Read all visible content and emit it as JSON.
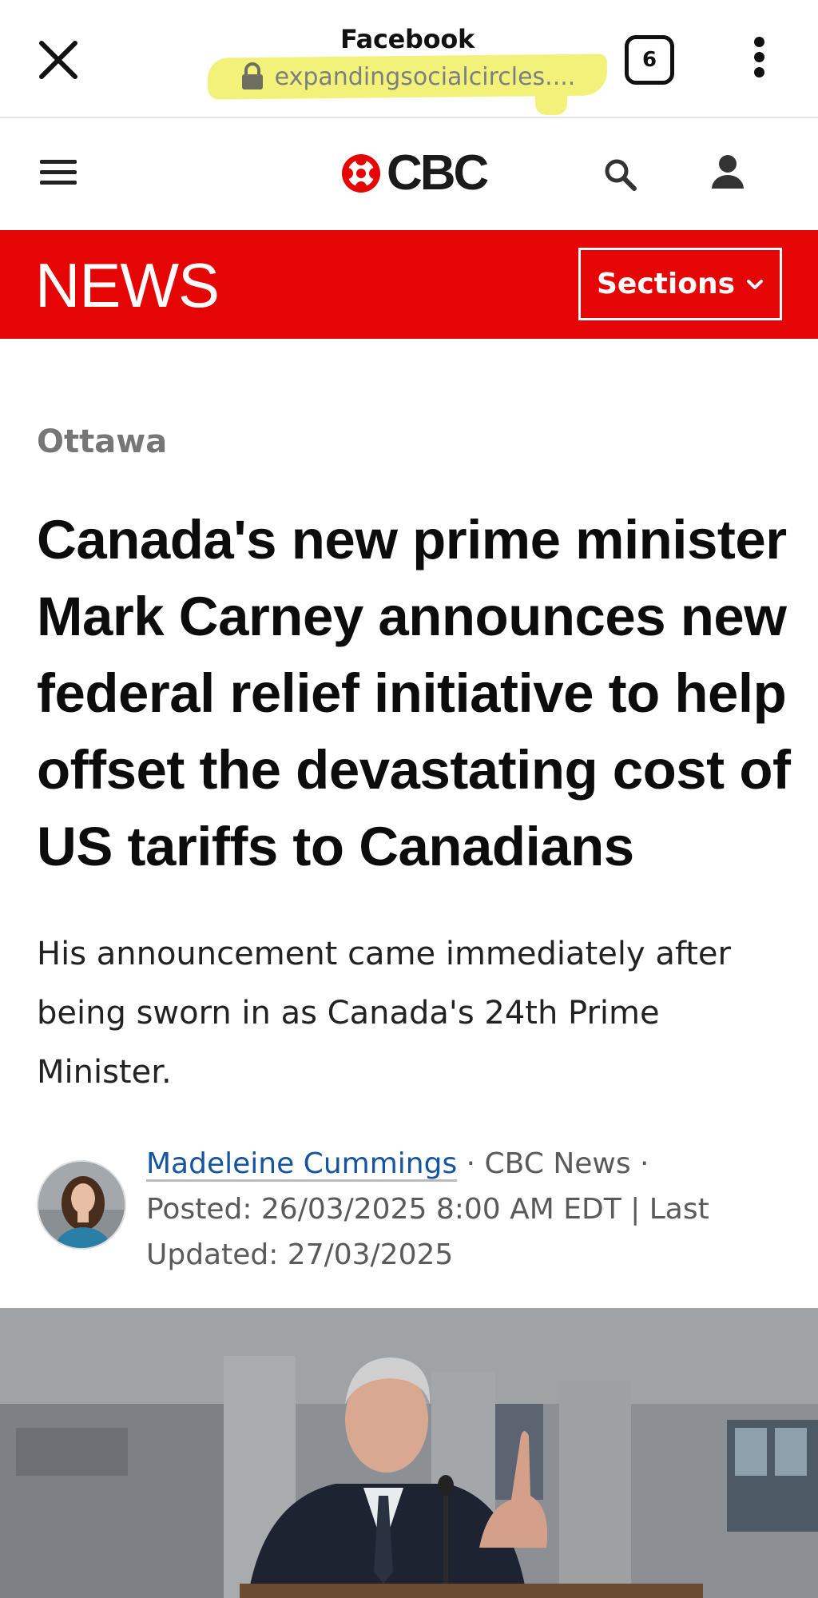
{
  "browser": {
    "title": "Facebook",
    "url": "expandingsocialcircles....",
    "tab_count": "6",
    "highlight_color": "#f2f27a",
    "icons": {
      "close": "close-icon",
      "lock": "lock-icon",
      "more": "more-vert-icon"
    }
  },
  "header": {
    "brand": "CBC",
    "brand_color": "#e60505",
    "icons": {
      "menu": "hamburger-icon",
      "search": "search-icon",
      "account": "account-icon"
    }
  },
  "banner": {
    "label": "NEWS",
    "sections_label": "Sections",
    "background": "#e60505"
  },
  "article": {
    "section": "Ottawa",
    "headline": "Canada's new prime minister Mark Carney announces new federal relief initiative to help offset the devastating cost of US tariffs to Canadians",
    "deck": "His announcement came immediately after being sworn in as Canada's 24th Prime Minister.",
    "byline": {
      "author": "Madeleine Cummings",
      "separator_1": " · ",
      "outlet": "CBC News",
      "separator_2": " ·",
      "posted": "Posted: 26/03/2025 8:00 AM EDT | Last Updated: 27/03/2025"
    }
  }
}
